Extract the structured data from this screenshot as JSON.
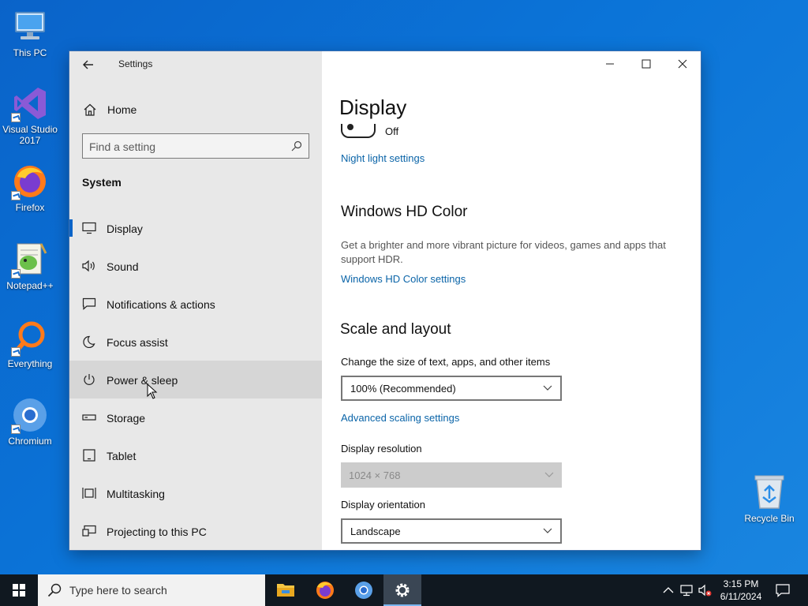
{
  "desktop": {
    "icons": [
      {
        "label": "This PC"
      },
      {
        "label": "Visual Studio 2017"
      },
      {
        "label": "Firefox"
      },
      {
        "label": "Notepad++"
      },
      {
        "label": "Everything"
      },
      {
        "label": "Chromium"
      }
    ],
    "recycle_bin": "Recycle Bin"
  },
  "window": {
    "title": "Settings",
    "sidebar": {
      "home_label": "Home",
      "search_placeholder": "Find a setting",
      "section": "System",
      "items": [
        {
          "label": "Display",
          "icon": "monitor-icon",
          "selected": true
        },
        {
          "label": "Sound",
          "icon": "speaker-icon"
        },
        {
          "label": "Notifications & actions",
          "icon": "message-icon"
        },
        {
          "label": "Focus assist",
          "icon": "moon-icon"
        },
        {
          "label": "Power & sleep",
          "icon": "power-icon",
          "hover": true
        },
        {
          "label": "Storage",
          "icon": "storage-icon"
        },
        {
          "label": "Tablet",
          "icon": "tablet-icon"
        },
        {
          "label": "Multitasking",
          "icon": "multitask-icon"
        },
        {
          "label": "Projecting to this PC",
          "icon": "projector-icon"
        }
      ]
    },
    "content": {
      "page_title": "Display",
      "night_light_state": "Off",
      "night_light_link": "Night light settings",
      "hd_color_heading": "Windows HD Color",
      "hd_color_desc": "Get a brighter and more vibrant picture for videos, games and apps that support HDR.",
      "hd_color_link": "Windows HD Color settings",
      "scale_heading": "Scale and layout",
      "scale_label": "Change the size of text, apps, and other items",
      "scale_value": "100% (Recommended)",
      "advanced_link": "Advanced scaling settings",
      "resolution_label": "Display resolution",
      "resolution_value": "1024 × 768",
      "orientation_label": "Display orientation",
      "orientation_value": "Landscape"
    }
  },
  "taskbar": {
    "search_placeholder": "Type here to search",
    "time": "3:15 PM",
    "date": "6/11/2024"
  },
  "colors": {
    "accent": "#0a64c8",
    "link": "#0a64a8",
    "sidebar_bg": "#e8e8e8"
  }
}
